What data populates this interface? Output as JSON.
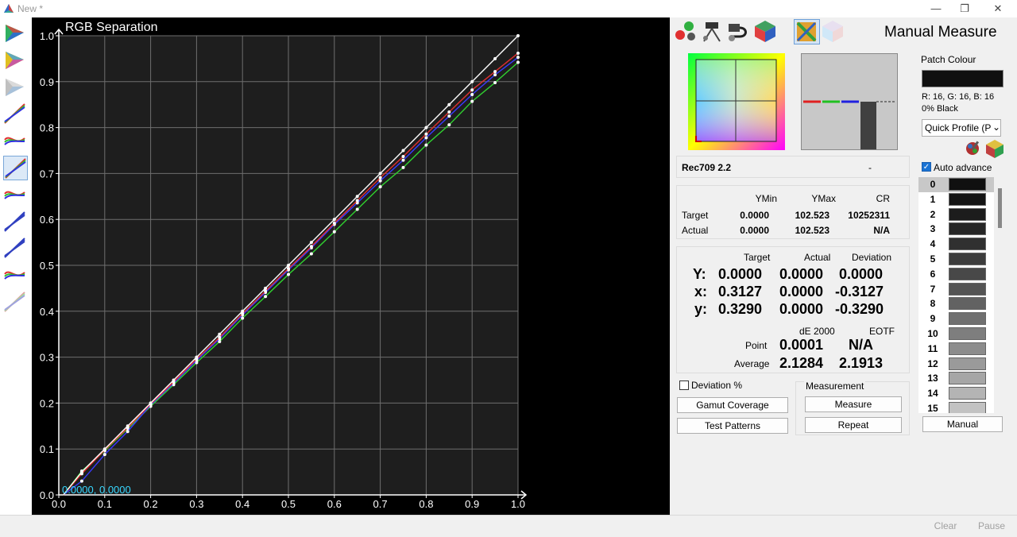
{
  "window": {
    "title": "New *",
    "minimize": "—",
    "maximize": "❐",
    "close": "✕"
  },
  "chart_data": {
    "type": "line",
    "title": "RGB Separation",
    "xlim": [
      0,
      1.0
    ],
    "ylim": [
      0,
      1.0
    ],
    "x_ticks": [
      "0.0",
      "0.1",
      "0.2",
      "0.3",
      "0.4",
      "0.5",
      "0.6",
      "0.7",
      "0.8",
      "0.9",
      "1.0"
    ],
    "y_ticks": [
      "0.0",
      "0.1",
      "0.2",
      "0.3",
      "0.4",
      "0.5",
      "0.6",
      "0.7",
      "0.8",
      "0.9",
      "1.0"
    ],
    "grid": true,
    "cursor_readout": "0.0000, 0.0000",
    "x": [
      0.05,
      0.1,
      0.15,
      0.2,
      0.25,
      0.3,
      0.35,
      0.4,
      0.45,
      0.5,
      0.55,
      0.6,
      0.65,
      0.7,
      0.75,
      0.8,
      0.85,
      0.9,
      0.95,
      1.0
    ],
    "series": [
      {
        "color": "#ffffff",
        "values": [
          0.05,
          0.1,
          0.15,
          0.2,
          0.25,
          0.3,
          0.35,
          0.4,
          0.45,
          0.5,
          0.55,
          0.6,
          0.65,
          0.7,
          0.75,
          0.8,
          0.85,
          0.9,
          0.95,
          1.0
        ]
      },
      {
        "color": "#e03030",
        "values": [
          0.046,
          0.098,
          0.146,
          0.198,
          0.246,
          0.296,
          0.343,
          0.395,
          0.444,
          0.493,
          0.541,
          0.592,
          0.641,
          0.691,
          0.737,
          0.786,
          0.834,
          0.882,
          0.922,
          0.962
        ]
      },
      {
        "color": "#3a3aff",
        "values": [
          0.03,
          0.088,
          0.138,
          0.196,
          0.243,
          0.293,
          0.34,
          0.392,
          0.441,
          0.49,
          0.538,
          0.589,
          0.636,
          0.684,
          0.729,
          0.778,
          0.825,
          0.872,
          0.915,
          0.953
        ]
      },
      {
        "color": "#30d030",
        "values": [
          0.052,
          0.096,
          0.144,
          0.193,
          0.24,
          0.288,
          0.334,
          0.385,
          0.432,
          0.48,
          0.525,
          0.573,
          0.622,
          0.671,
          0.713,
          0.762,
          0.806,
          0.857,
          0.898,
          0.942
        ]
      }
    ]
  },
  "left_toolbar": [
    {
      "icon": "cie-diagram-icon"
    },
    {
      "icon": "cie-triangle-icon"
    },
    {
      "icon": "gamut-3d-icon"
    },
    {
      "icon": "rgb-balance-icon"
    },
    {
      "icon": "rgb-levels-icon"
    },
    {
      "icon": "rgb-separation-icon",
      "active": true
    },
    {
      "icon": "rgb-gamma-icon"
    },
    {
      "icon": "gamma-curve-icon"
    },
    {
      "icon": "luminance-icon"
    },
    {
      "icon": "color-comparator-icon"
    },
    {
      "icon": "spectrum-icon"
    }
  ],
  "right_panel": {
    "title": "Manual Measure",
    "toolbar_icons": [
      "probe-icon",
      "tripod-icon",
      "sensor-icon",
      "cube-icon",
      "pattern-icon",
      "gamut-cube-icon"
    ],
    "patch_colour": {
      "label": "Patch Colour",
      "swatch": "#101010",
      "rgb_text": "R: 16, G: 16, B: 16",
      "name": "0% Black"
    },
    "profile_select": "Quick Profile (P",
    "auto_advance": {
      "label": "Auto advance",
      "checked": true
    },
    "colour_space": {
      "name": "Rec709 2.2",
      "dash": "-"
    },
    "summary": {
      "headers": [
        "YMin",
        "YMax",
        "CR"
      ],
      "rows": [
        {
          "label": "Target",
          "values": [
            "0.0000",
            "102.523",
            "10252311"
          ]
        },
        {
          "label": "Actual",
          "values": [
            "0.0000",
            "102.523",
            "N/A"
          ]
        }
      ]
    },
    "measurements": {
      "headers": [
        "Target",
        "Actual",
        "Deviation"
      ],
      "rows": [
        {
          "label": "Y:",
          "values": [
            "0.0000",
            "0.0000",
            "0.0000"
          ]
        },
        {
          "label": "x:",
          "values": [
            "0.3127",
            "0.0000",
            "-0.3127"
          ]
        },
        {
          "label": "y:",
          "values": [
            "0.3290",
            "0.0000",
            "-0.3290"
          ]
        }
      ],
      "de_headers": [
        "dE 2000",
        "EOTF"
      ],
      "point": {
        "label": "Point",
        "de": "0.0001",
        "eotf": "N/A"
      },
      "average": {
        "label": "Average",
        "de": "2.1284",
        "eotf": "2.1913"
      }
    },
    "deviation_pct": {
      "label": "Deviation %",
      "checked": false
    },
    "buttons": {
      "gamut_coverage": "Gamut Coverage",
      "test_patterns": "Test Patterns",
      "measurement_group": "Measurement",
      "measure": "Measure",
      "repeat": "Repeat",
      "manual": "Manual"
    },
    "patches": [
      {
        "n": "0",
        "color": "#101010"
      },
      {
        "n": "1",
        "color": "#141414"
      },
      {
        "n": "2",
        "color": "#1c1c1c"
      },
      {
        "n": "3",
        "color": "#262626"
      },
      {
        "n": "4",
        "color": "#303030"
      },
      {
        "n": "5",
        "color": "#3c3c3c"
      },
      {
        "n": "6",
        "color": "#484848"
      },
      {
        "n": "7",
        "color": "#545454"
      },
      {
        "n": "8",
        "color": "#626262"
      },
      {
        "n": "9",
        "color": "#707070"
      },
      {
        "n": "10",
        "color": "#7e7e7e"
      },
      {
        "n": "11",
        "color": "#8c8c8c"
      },
      {
        "n": "12",
        "color": "#9a9a9a"
      },
      {
        "n": "13",
        "color": "#a6a6a6"
      },
      {
        "n": "14",
        "color": "#b4b4b4"
      },
      {
        "n": "15",
        "color": "#c2c2c2"
      }
    ]
  },
  "statusbar": {
    "clear": "Clear",
    "pause": "Pause"
  }
}
